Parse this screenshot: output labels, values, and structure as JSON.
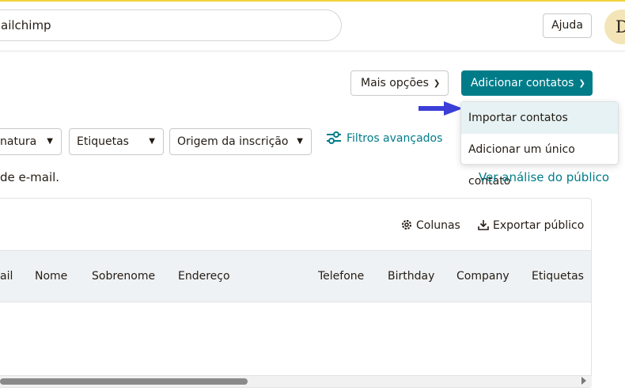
{
  "topbar": {
    "search_value": "ailchimp",
    "help_label": "Ajuda",
    "avatar_initial": "D"
  },
  "actions": {
    "more_options_label": "Mais opções",
    "add_contacts_label": "Adicionar contatos"
  },
  "dropdown": {
    "items": [
      "Importar contatos",
      "Adicionar um único contato"
    ]
  },
  "filters": {
    "items": [
      "natura",
      "Etiquetas",
      "Origem da inscrição"
    ],
    "advanced_label": "Filtros avançados"
  },
  "summary": {
    "description": "de e-mail.",
    "audience_link": "Ver análise do público"
  },
  "table": {
    "columns_label": "Colunas",
    "export_label": "Exportar público",
    "headers": [
      "ail",
      "Nome",
      "Sobrenome",
      "Endereço",
      "Telefone",
      "Birthday",
      "Company",
      "Etiquetas"
    ]
  },
  "colors": {
    "accent": "#007c89",
    "highlight": "#e6f2f3",
    "arrow": "#3b3fd8"
  }
}
